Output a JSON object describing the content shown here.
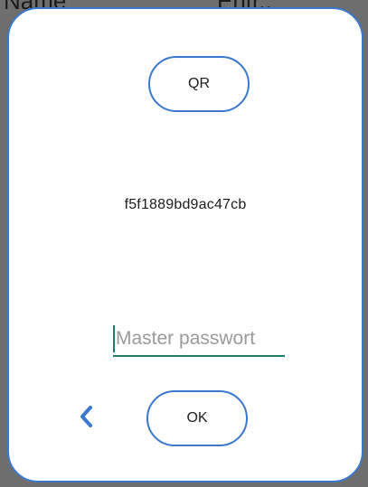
{
  "background": {
    "name_text": "Name",
    "entry_text": "Entr.."
  },
  "dialog": {
    "qr_button_label": "QR",
    "hash_value": "f5f1889bd9ac47cb",
    "password_placeholder": "Master passwort",
    "password_value": "",
    "ok_button_label": "OK",
    "back_icon": "chevron-left-icon"
  },
  "colors": {
    "accent": "#3a78d0",
    "input_underline": "#1f7a6e",
    "overlay": "#6e6e6e"
  }
}
